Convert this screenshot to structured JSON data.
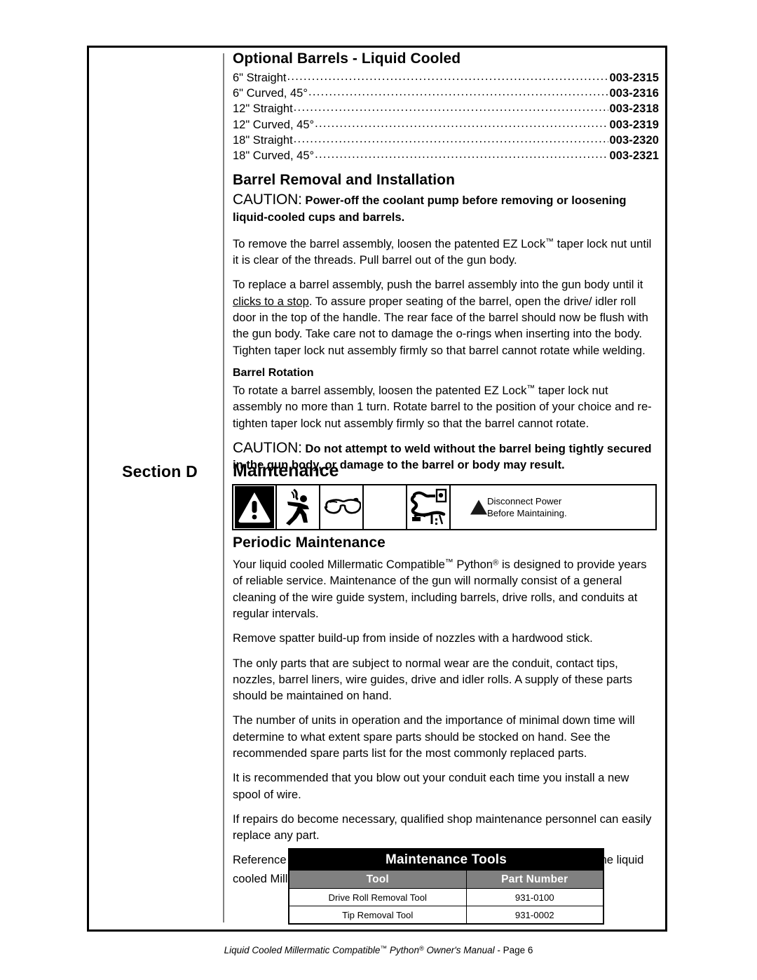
{
  "page": {
    "footer_text": "Liquid Cooled Millermatic Compatible™ Python® Owner's Manual",
    "footer_page": "- Page 6"
  },
  "optional_barrels": {
    "heading": "Optional Barrels - Liquid Cooled",
    "items": [
      {
        "name": "6\" Straight",
        "part": "003-2315"
      },
      {
        "name": "6\" Curved, 45°",
        "part": "003-2316"
      },
      {
        "name": "12\" Straight",
        "part": "003-2318"
      },
      {
        "name": "12\" Curved, 45°",
        "part": "003-2319"
      },
      {
        "name": "18\" Straight",
        "part": "003-2320"
      },
      {
        "name": "18\" Curved, 45°",
        "part": "003-2321"
      }
    ]
  },
  "barrel_removal": {
    "heading": "Barrel Removal and Installation",
    "caution_word": "CAUTION:",
    "caution_text": "Power-off the coolant pump before removing or loosening liquid-cooled cups and barrels.",
    "para1": "To remove the barrel assembly, loosen the patented EZ Lock™ taper lock nut until it is clear of the threads.  Pull barrel out of the gun body.",
    "para2_a": "To replace a barrel assembly, push the barrel assembly into the gun body until it ",
    "para2_underlined": "clicks to a stop",
    "para2_b": ".  To assure proper seating of the barrel, open the drive/ idler roll door in the top of the handle.  The rear face of the barrel should now be flush with the gun body.  Take care not to damage the o-rings when inserting into the body.  Tighten taper lock nut assembly firmly so that barrel cannot rotate while welding.",
    "rotation_heading": "Barrel Rotation",
    "rotation_text": "To rotate a barrel assembly, loosen the patented EZ Lock™ taper lock nut assembly no more than 1 turn.  Rotate barrel to the position of your choice and re-tighten taper lock nut assembly firmly so that the barrel cannot rotate.",
    "caution2_word": "CAUTION:",
    "caution2_text": "Do not attempt to weld without the barrel being tightly secured in the gun body, or damage to the barrel or body may result."
  },
  "section_d": {
    "label": "Section D",
    "title": "Maintenance"
  },
  "safety_strip": {
    "icons": [
      "warning-triangle-icon",
      "electric-shock-icon",
      "safety-glasses-icon",
      "blank-icon",
      "unplug-power-icon"
    ],
    "notice_line1": "Disconnect Power",
    "notice_line2": "Before Maintaining."
  },
  "periodic_maintenance": {
    "heading": "Periodic Maintenance",
    "paragraphs": [
      "Your liquid cooled Millermatic Compatible™ Python® is designed to provide years of reliable service.  Maintenance of the gun will normally consist of a general cleaning of the wire guide system, including barrels, drive rolls, and conduits at regular intervals.",
      "Remove spatter build-up from inside of nozzles with a hardwood stick.",
      "The only parts that are subject to normal wear are the conduit, contact tips, nozzles, barrel liners, wire guides, drive and idler rolls.  A supply of these parts should be maintained on hand.",
      "The number of units in operation and the importance of minimal down time will determine to what extent spare parts should be stocked on hand.  See the recommended spare parts list for the most commonly replaced parts.",
      "It is recommended that you blow out your conduit each time you install a new spool of wire.",
      "If repairs do become necessary, qualified shop maintenance personnel can easily replace any part.",
      "Reference the table below for suggested Maintenance Tools used with the liquid cooled Millermatic Compatible™ Python® welding gun."
    ]
  },
  "tools_table": {
    "title": "Maintenance Tools",
    "columns": [
      "Tool",
      "Part Number"
    ],
    "rows": [
      {
        "tool": "Drive Roll Removal Tool",
        "part": "931-0100"
      },
      {
        "tool": "Tip Removal Tool",
        "part": "931-0002"
      }
    ]
  },
  "colors": {
    "black": "#000000",
    "gray_header": "#808080",
    "divider_gray": "#808080"
  }
}
